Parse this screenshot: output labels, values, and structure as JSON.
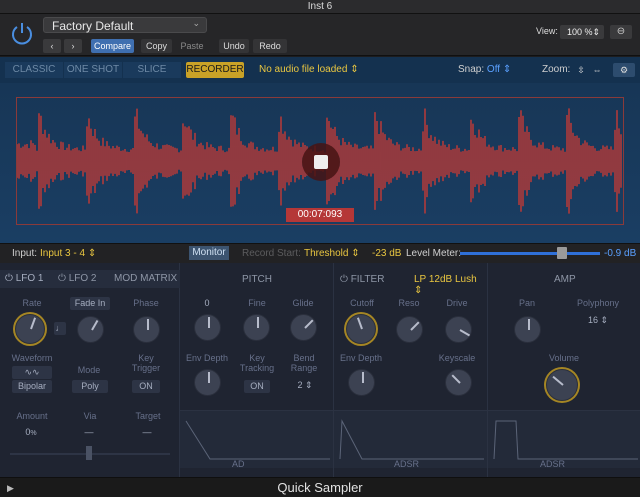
{
  "window": {
    "title": "Inst 6"
  },
  "header": {
    "preset_name": "Factory Default",
    "compare_label": "Compare",
    "copy_label": "Copy",
    "paste_label": "Paste",
    "undo_label": "Undo",
    "redo_label": "Redo",
    "view_label": "View:",
    "view_value": "100 %"
  },
  "modes": {
    "classic": "CLASSIC",
    "one_shot": "ONE SHOT",
    "slice": "SLICE",
    "recorder": "RECORDER",
    "file_status": "No audio file loaded",
    "snap_label": "Snap:",
    "snap_value": "Off",
    "zoom_label": "Zoom:"
  },
  "waveform": {
    "time": "00:07:093",
    "colors": {
      "wave": "#b03a3a",
      "background": "#173656",
      "frame": "#8a3a3a"
    },
    "beats": 12
  },
  "input_bar": {
    "input_label": "Input:",
    "input_value": "Input 3 - 4",
    "monitor_label": "Monitor",
    "record_start_label": "Record Start:",
    "threshold_value": "Threshold",
    "threshold_db": "-23 dB",
    "level_meter_label": "Level Meter:",
    "level_value": "-0.9 dB"
  },
  "lfo": {
    "tab1": "LFO 1",
    "tab2": "LFO 2",
    "tab3": "MOD MATRIX",
    "rate_label": "Rate",
    "fade_in_label": "Fade In",
    "phase_label": "Phase",
    "waveform_label": "Waveform",
    "waveform_value": "Bipolar",
    "mode_label": "Mode",
    "mode_value": "Poly",
    "key_trigger_label": "Key Trigger",
    "key_trigger_value": "ON",
    "amount_label": "Amount",
    "amount_value": "0",
    "amount_unit": "%",
    "via_label": "Via",
    "via_value": "—",
    "target_label": "Target",
    "target_value": "—"
  },
  "pitch": {
    "title": "PITCH",
    "coarse_value": "0",
    "fine_label": "Fine",
    "glide_label": "Glide",
    "env_depth_label": "Env Depth",
    "key_tracking_label": "Key Tracking",
    "key_tracking_value": "ON",
    "bend_range_label": "Bend Range",
    "bend_range_value": "2",
    "env_name": "AD"
  },
  "filter": {
    "title": "FILTER",
    "type_value": "LP 12dB Lush",
    "cutoff_label": "Cutoff",
    "reso_label": "Reso",
    "drive_label": "Drive",
    "env_depth_label": "Env Depth",
    "keyscale_label": "Keyscale",
    "env_name": "ADSR"
  },
  "amp": {
    "title": "AMP",
    "pan_label": "Pan",
    "polyphony_label": "Polyphony",
    "polyphony_value": "16",
    "volume_label": "Volume",
    "env_name": "ADSR"
  },
  "status": {
    "plugin_name": "Quick Sampler"
  }
}
